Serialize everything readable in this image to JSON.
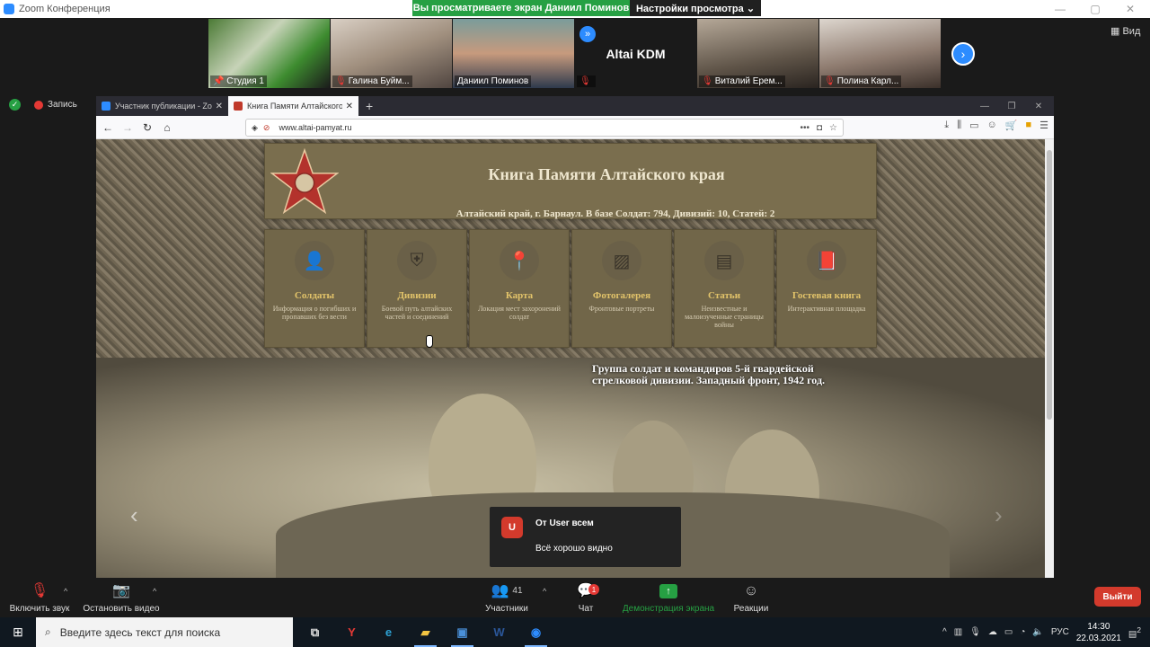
{
  "zoom": {
    "window_title": "Zoom Конференция",
    "share_banner": "Вы просматриваете экран Даниил Поминов",
    "view_options": "Настройки просмотра ⌄",
    "view_button": "Вид",
    "record_label": "Запись",
    "participants": [
      {
        "name": "Студия 1",
        "muted": false
      },
      {
        "name": "Галина Буйм...",
        "muted": true
      },
      {
        "name": "Даниил Поминов",
        "muted": false
      },
      {
        "name": "Altai KDM",
        "muted": true
      },
      {
        "name": "Виталий Ерем...",
        "muted": true
      },
      {
        "name": "Полина Карл...",
        "muted": true
      }
    ]
  },
  "browser": {
    "tabs": [
      {
        "label": "Участник публикации - Zoom",
        "active": false
      },
      {
        "label": "Книга Памяти Алтайского кр...",
        "active": true
      }
    ],
    "url": "www.altai-pamyat.ru"
  },
  "site": {
    "title": "Книга Памяти Алтайского края",
    "subtitle": "Алтайский край, г. Барнаул. В базе Солдат: 794, Дивизий: 10, Статей: 2",
    "cards": [
      {
        "icon": "user-icon",
        "title": "Солдаты",
        "desc": "Информация о погибших и пропавших без вести"
      },
      {
        "icon": "shield-icon",
        "title": "Дивизии",
        "desc": "Боевой путь алтайских частей и соединений"
      },
      {
        "icon": "map-pin-icon",
        "title": "Карта",
        "desc": "Локация мест захоронений солдат"
      },
      {
        "icon": "image-icon",
        "title": "Фотогалерея",
        "desc": "Фронтовые портреты"
      },
      {
        "icon": "document-icon",
        "title": "Статьи",
        "desc": "Неизвестные и малоизученные страницы войны"
      },
      {
        "icon": "book-icon",
        "title": "Гостевая книга",
        "desc": "Интерактивная площадка"
      }
    ],
    "photo_caption": "Группа солдат и командиров 5-й гвардейской стрелковой дивизии. Западный фронт, 1942 год."
  },
  "chat_popup": {
    "avatar_letter": "U",
    "from": "От User всем",
    "message": "Всё хорошо видно"
  },
  "toolbar": {
    "mute_label": "Включить звук",
    "video_label": "Остановить видео",
    "participants_label": "Участники",
    "participants_count": "41",
    "chat_label": "Чат",
    "chat_badge": "1",
    "share_label": "Демонстрация экрана",
    "reactions_label": "Реакции",
    "leave_label": "Выйти"
  },
  "taskbar": {
    "search_placeholder": "Введите здесь текст для поиска",
    "lang": "РУС",
    "time": "14:30",
    "date": "22.03.2021",
    "notif_count": "2"
  }
}
